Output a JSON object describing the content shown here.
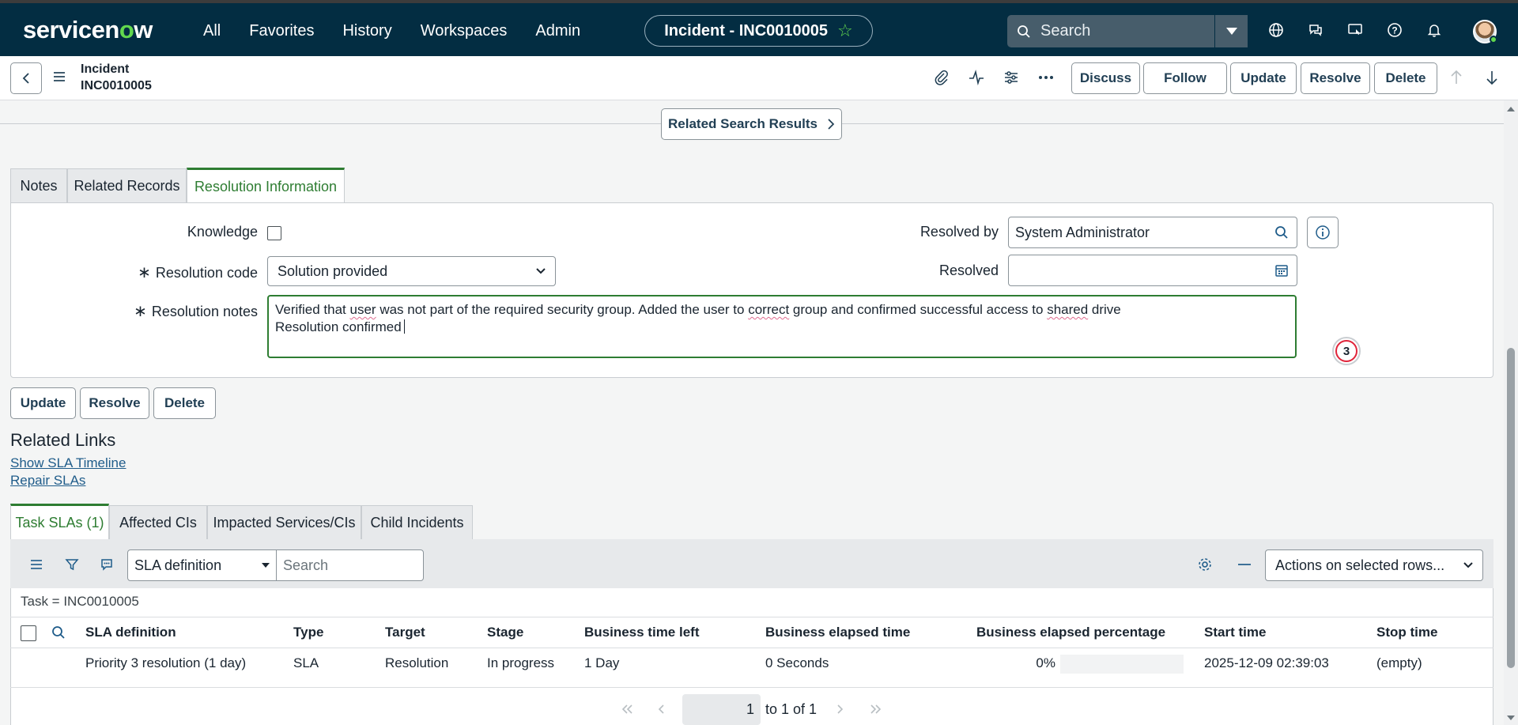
{
  "header": {
    "logo": "servicenow",
    "nav": [
      "All",
      "Favorites",
      "History",
      "Workspaces",
      "Admin"
    ],
    "context_title": "Incident - INC0010005",
    "search_placeholder": "Search"
  },
  "record": {
    "table": "Incident",
    "number": "INC0010005",
    "buttons": [
      "Discuss",
      "Follow",
      "Update",
      "Resolve",
      "Delete"
    ]
  },
  "related_search_results": "Related Search Results",
  "form_tabs": [
    "Notes",
    "Related Records",
    "Resolution Information"
  ],
  "form": {
    "knowledge_label": "Knowledge",
    "resolution_code_label": "Resolution code",
    "resolution_code_value": "Solution provided",
    "resolution_notes_label": "Resolution notes",
    "notes_line1_parts": [
      "Verified that ",
      "user",
      " was not part of the required security group. Added the user to ",
      "correct",
      " group and confirmed successful access to ",
      "shared",
      " drive"
    ],
    "notes_line2": "Resolution confirmed",
    "resolved_by_label": "Resolved by",
    "resolved_by_value": "System Administrator",
    "resolved_label": "Resolved",
    "resolved_value": "",
    "badge_count": "3",
    "required_marker": "∗"
  },
  "form_buttons": [
    "Update",
    "Resolve",
    "Delete"
  ],
  "related_links": {
    "title": "Related Links",
    "links": [
      "Show SLA Timeline",
      "Repair SLAs"
    ]
  },
  "list_tabs": [
    "Task SLAs (1)",
    "Affected CIs",
    "Impacted Services/CIs",
    "Child Incidents"
  ],
  "list": {
    "field_select": "SLA definition",
    "search_placeholder": "Search",
    "actions_select": "Actions on selected rows...",
    "breadcrumb": "Task = INC0010005",
    "columns": [
      "SLA definition",
      "Type",
      "Target",
      "Stage",
      "Business time left",
      "Business elapsed time",
      "Business elapsed percentage",
      "Start time",
      "Stop time"
    ],
    "rows": [
      [
        "Priority 3 resolution (1 day)",
        "SLA",
        "Resolution",
        "In progress",
        "1 Day",
        "0 Seconds",
        "0%",
        "2025-12-09 02:39:03",
        "(empty)"
      ]
    ],
    "elapsed_percentage_fill": 0,
    "pager_page": "1",
    "pager_text": "to 1 of 1"
  },
  "colors": {
    "header_bg": "#032d42",
    "accent_green": "#2e7d32",
    "brand_green": "#62d84e",
    "link_blue": "#1f5c8a"
  }
}
